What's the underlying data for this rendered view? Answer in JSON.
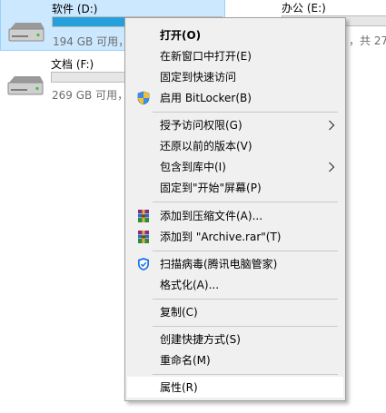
{
  "drives": {
    "software": {
      "name": "软件 (D:)",
      "info_visible": "194 GB 可用，",
      "used_fraction": 0.55,
      "bar_color": "#26a0da"
    },
    "office": {
      "name": "办公 (E:)",
      "info_visible": "，共 27"
    },
    "docs": {
      "name": "文档 (F:)",
      "info_visible": "269 GB 可用，"
    }
  },
  "context_menu": {
    "items": {
      "open": "打开(O)",
      "open_new_window": "在新窗口中打开(E)",
      "pin_quick_access": "固定到快速访问",
      "bitlocker": "启用 BitLocker(B)",
      "grant_access": "授予访问权限(G)",
      "restore_versions": "还原以前的版本(V)",
      "include_library": "包含到库中(I)",
      "pin_start": "固定到\"开始\"屏幕(P)",
      "add_archive": "添加到压缩文件(A)...",
      "add_archive_rar": "添加到 \"Archive.rar\"(T)",
      "scan_virus": "扫描病毒(腾讯电脑管家)",
      "format": "格式化(A)...",
      "copy": "复制(C)",
      "create_shortcut": "创建快捷方式(S)",
      "rename": "重命名(M)",
      "properties": "属性(R)"
    },
    "icons": {
      "bitlocker": "uac-shield-icon",
      "winrar": "winrar-icon",
      "antivirus": "tencent-pc-manager-icon",
      "submenu": "chevron-right-icon"
    },
    "colors": {
      "background": "#f0f0f0",
      "hover": "#ffffff",
      "separator": "#c9c9c9"
    }
  }
}
